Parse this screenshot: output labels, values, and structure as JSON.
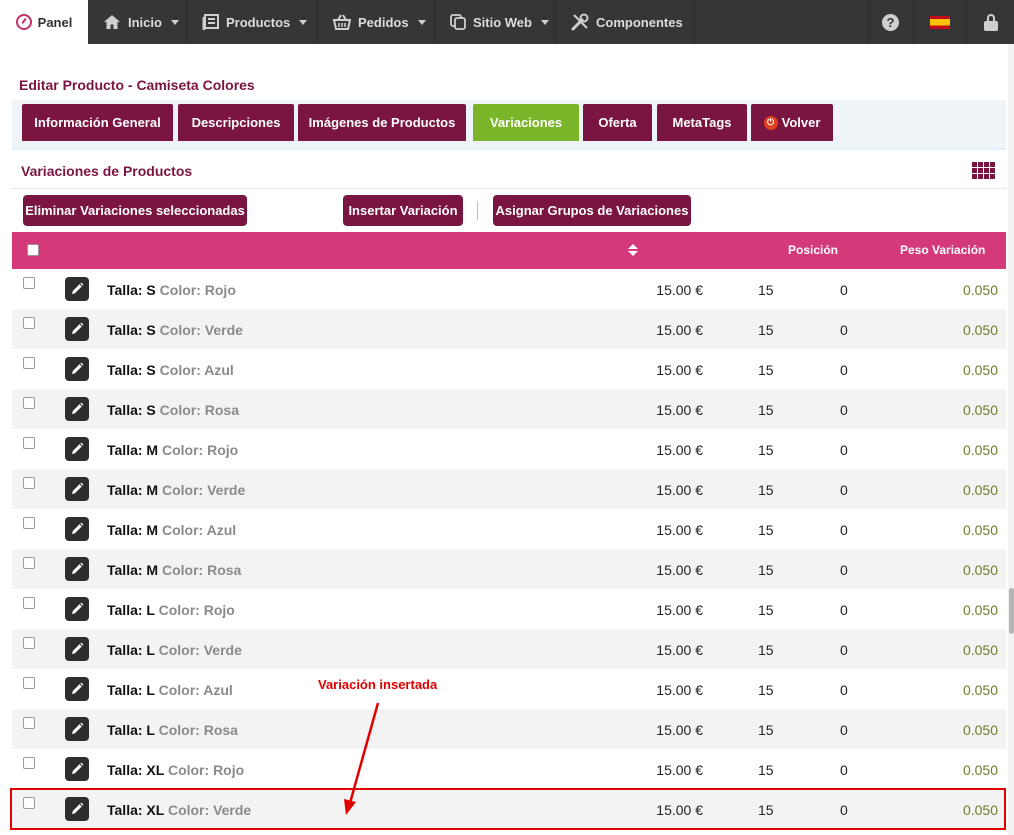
{
  "nav": {
    "panel_label": "Panel",
    "items": [
      {
        "label": "Inicio",
        "icon": "home-icon"
      },
      {
        "label": "Productos",
        "icon": "products-icon"
      },
      {
        "label": "Pedidos",
        "icon": "basket-icon"
      },
      {
        "label": "Sitio Web",
        "icon": "copy-icon"
      },
      {
        "label": "Componentes",
        "icon": "tools-icon"
      }
    ],
    "help_glyph": "?",
    "language_flag": "flag-es-icon"
  },
  "page_title": "Editar Producto - Camiseta Colores",
  "tabs": [
    {
      "label": "Información General"
    },
    {
      "label": "Descripciones"
    },
    {
      "label": "Imágenes de Productos"
    },
    {
      "label": "Variaciones",
      "active": true
    },
    {
      "label": "Oferta"
    },
    {
      "label": "MetaTags"
    },
    {
      "label": "Volver",
      "icon": "power-icon"
    }
  ],
  "section_title": "Variaciones de Productos",
  "buttons": {
    "delete_selected": "Eliminar Variaciones seleccionadas",
    "insert": "Insertar Variación",
    "assign_groups": "Asignar Grupos de Variaciones"
  },
  "table": {
    "headers": {
      "position": "Posición",
      "weight": "Peso Variación"
    },
    "rows": [
      {
        "talla_key": "Talla:",
        "talla": "S",
        "color_key": "Color:",
        "color": "Rojo",
        "price": "15.00 €",
        "stock": "15",
        "position": "0",
        "weight": "0.050"
      },
      {
        "talla_key": "Talla:",
        "talla": "S",
        "color_key": "Color:",
        "color": "Verde",
        "price": "15.00 €",
        "stock": "15",
        "position": "0",
        "weight": "0.050"
      },
      {
        "talla_key": "Talla:",
        "talla": "S",
        "color_key": "Color:",
        "color": "Azul",
        "price": "15.00 €",
        "stock": "15",
        "position": "0",
        "weight": "0.050"
      },
      {
        "talla_key": "Talla:",
        "talla": "S",
        "color_key": "Color:",
        "color": "Rosa",
        "price": "15.00 €",
        "stock": "15",
        "position": "0",
        "weight": "0.050"
      },
      {
        "talla_key": "Talla:",
        "talla": "M",
        "color_key": "Color:",
        "color": "Rojo",
        "price": "15.00 €",
        "stock": "15",
        "position": "0",
        "weight": "0.050"
      },
      {
        "talla_key": "Talla:",
        "talla": "M",
        "color_key": "Color:",
        "color": "Verde",
        "price": "15.00 €",
        "stock": "15",
        "position": "0",
        "weight": "0.050"
      },
      {
        "talla_key": "Talla:",
        "talla": "M",
        "color_key": "Color:",
        "color": "Azul",
        "price": "15.00 €",
        "stock": "15",
        "position": "0",
        "weight": "0.050"
      },
      {
        "talla_key": "Talla:",
        "talla": "M",
        "color_key": "Color:",
        "color": "Rosa",
        "price": "15.00 €",
        "stock": "15",
        "position": "0",
        "weight": "0.050"
      },
      {
        "talla_key": "Talla:",
        "talla": "L",
        "color_key": "Color:",
        "color": "Rojo",
        "price": "15.00 €",
        "stock": "15",
        "position": "0",
        "weight": "0.050"
      },
      {
        "talla_key": "Talla:",
        "talla": "L",
        "color_key": "Color:",
        "color": "Verde",
        "price": "15.00 €",
        "stock": "15",
        "position": "0",
        "weight": "0.050"
      },
      {
        "talla_key": "Talla:",
        "talla": "L",
        "color_key": "Color:",
        "color": "Azul",
        "price": "15.00 €",
        "stock": "15",
        "position": "0",
        "weight": "0.050"
      },
      {
        "talla_key": "Talla:",
        "talla": "L",
        "color_key": "Color:",
        "color": "Rosa",
        "price": "15.00 €",
        "stock": "15",
        "position": "0",
        "weight": "0.050"
      },
      {
        "talla_key": "Talla:",
        "talla": "XL",
        "color_key": "Color:",
        "color": "Rojo",
        "price": "15.00 €",
        "stock": "15",
        "position": "0",
        "weight": "0.050"
      },
      {
        "talla_key": "Talla:",
        "talla": "XL",
        "color_key": "Color:",
        "color": "Verde",
        "price": "15.00 €",
        "stock": "15",
        "position": "0",
        "weight": "0.050"
      }
    ]
  },
  "annotation": "Variación insertada",
  "colors": {
    "brand": "#7a1440",
    "header": "#d43a7a",
    "active_tab": "#7ab52a",
    "annotation": "#e00000",
    "weight_text": "#6a7f2a"
  }
}
